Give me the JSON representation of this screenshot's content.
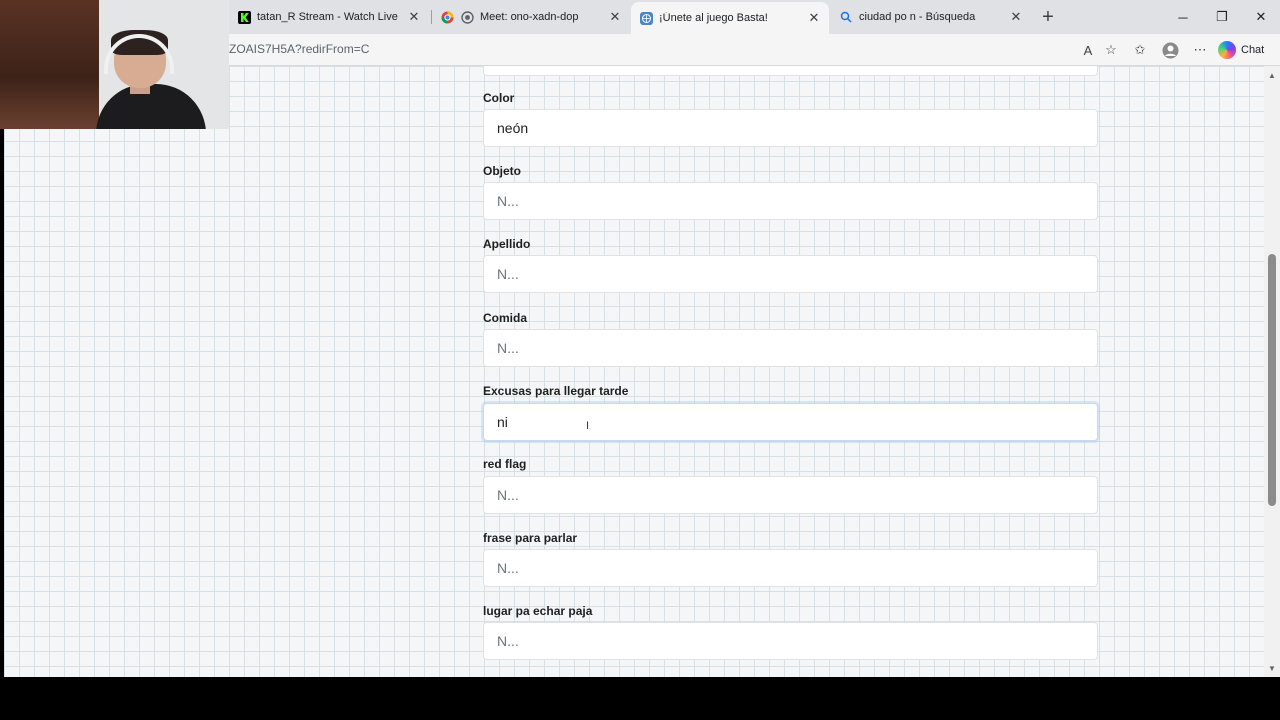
{
  "browser": {
    "tabs": [
      {
        "title": "tatan_R Stream - Watch Live on Ki",
        "icon": "kick-icon",
        "active": false
      },
      {
        "title": "Meet: ono-xadn-dop",
        "icon": "meet-icon",
        "active": false
      },
      {
        "title": "¡Únete al juego Basta!",
        "icon": "globe-icon",
        "active": true
      },
      {
        "title": "ciudad po n - Búsqueda",
        "icon": "search-icon",
        "active": false
      }
    ],
    "url": "ZOAIS7H5A?redirFrom=C",
    "chat_label": "Chat",
    "colors": {
      "accent": "#1a73e8",
      "kick_green": "#53fc18"
    }
  },
  "form": {
    "fields": [
      {
        "label": "Color",
        "value": "neón",
        "placeholder": "N..."
      },
      {
        "label": "Objeto",
        "value": "",
        "placeholder": "N..."
      },
      {
        "label": "Apellido",
        "value": "",
        "placeholder": "N..."
      },
      {
        "label": "Comida",
        "value": "",
        "placeholder": "N..."
      },
      {
        "label": "Excusas para llegar tarde",
        "value": "ni",
        "placeholder": "N..."
      },
      {
        "label": "red flag",
        "value": "",
        "placeholder": "N..."
      },
      {
        "label": "frase para parlar",
        "value": "",
        "placeholder": "N..."
      },
      {
        "label": "lugar pa echar paja",
        "value": "",
        "placeholder": "N..."
      }
    ]
  }
}
